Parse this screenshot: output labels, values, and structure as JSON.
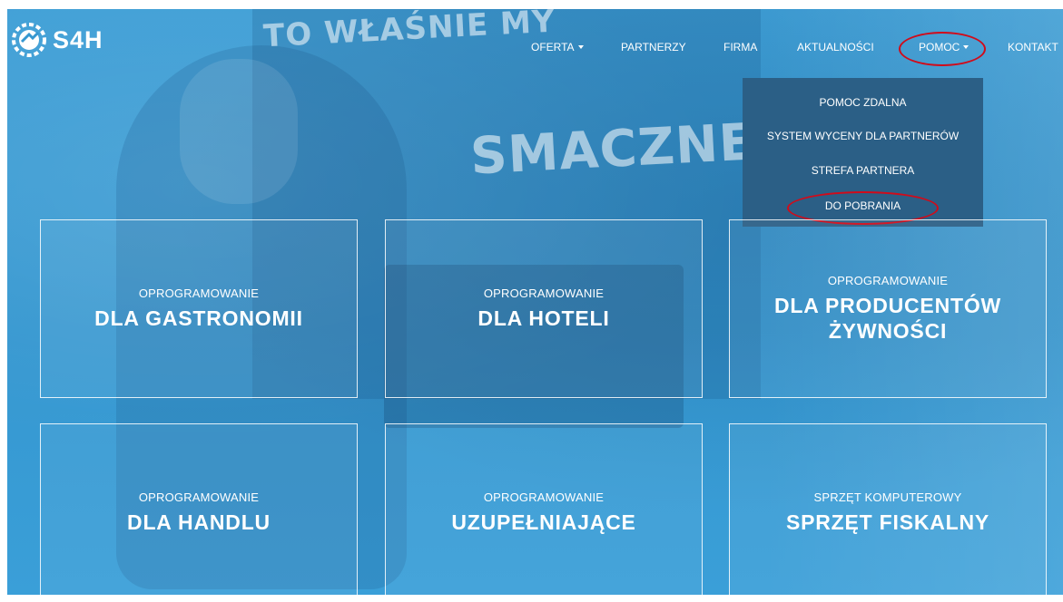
{
  "hero": {
    "chalk_top": "TO WŁAŚNIE MY",
    "chalk_mid": "SMACZNEGO"
  },
  "logo": {
    "text": "S4H",
    "icon": "s4h-gear-logo"
  },
  "nav": {
    "items": [
      {
        "label": "OFERTA",
        "has_caret": true
      },
      {
        "label": "PARTNERZY",
        "has_caret": false
      },
      {
        "label": "FIRMA",
        "has_caret": false
      },
      {
        "label": "AKTUALNOŚCI",
        "has_caret": false
      },
      {
        "label": "POMOC",
        "has_caret": true,
        "active": true
      },
      {
        "label": "KONTAKT",
        "has_caret": false
      }
    ]
  },
  "dropdown": {
    "items": [
      {
        "label": "POMOC ZDALNA"
      },
      {
        "label": "SYSTEM WYCENY DLA PARTNERÓW"
      },
      {
        "label": "STREFA PARTNERA"
      },
      {
        "label": "DO POBRANIA",
        "highlighted": true
      }
    ]
  },
  "tiles": [
    {
      "subtitle": "OPROGRAMOWANIE",
      "title": "DLA GASTRONOMII"
    },
    {
      "subtitle": "OPROGRAMOWANIE",
      "title": "DLA HOTELI"
    },
    {
      "subtitle": "OPROGRAMOWANIE",
      "title": "DLA PRODUCENTÓW",
      "title2": "ŻYWNOŚCI"
    },
    {
      "subtitle": "OPROGRAMOWANIE",
      "title": "DLA HANDLU"
    },
    {
      "subtitle": "OPROGRAMOWANIE",
      "title": "UZUPEŁNIAJĄCE"
    },
    {
      "subtitle": "SPRZĘT KOMPUTEROWY",
      "title": "SPRZĘT FISKALNY"
    }
  ],
  "colors": {
    "hero_blue": "#3597d0",
    "dropdown_bg": "#2b5f86",
    "annotation_red": "#d10b1a"
  }
}
